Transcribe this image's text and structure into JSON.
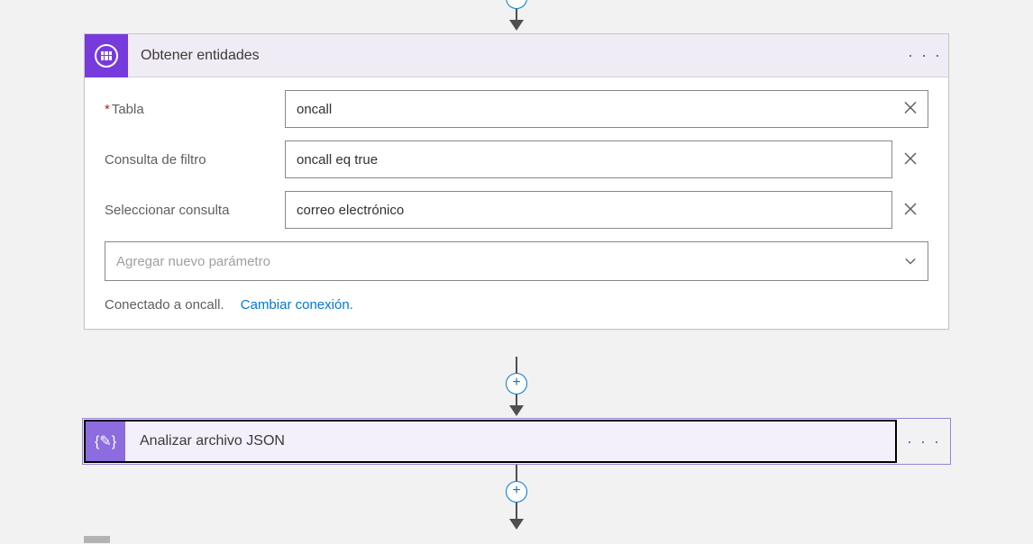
{
  "flow": {
    "card1": {
      "icon_name": "table-storage-icon",
      "title": "Obtener entidades",
      "params": {
        "tabla": {
          "label": "Tabla",
          "required": true,
          "value": "oncall"
        },
        "filtro": {
          "label": "Consulta de filtro",
          "required": false,
          "value": "oncall eq true"
        },
        "select": {
          "label": "Seleccionar consulta",
          "required": false,
          "value": "correo electrónico"
        }
      },
      "add_param_placeholder": "Agregar nuevo parámetro",
      "connection_text": "Conectado a oncall.",
      "change_connection_label": "Cambiar conexión."
    },
    "card2": {
      "icon_name": "data-operation-icon",
      "title": "Analizar archivo JSON"
    },
    "menu_dots": "· · ·",
    "plus": "+"
  }
}
